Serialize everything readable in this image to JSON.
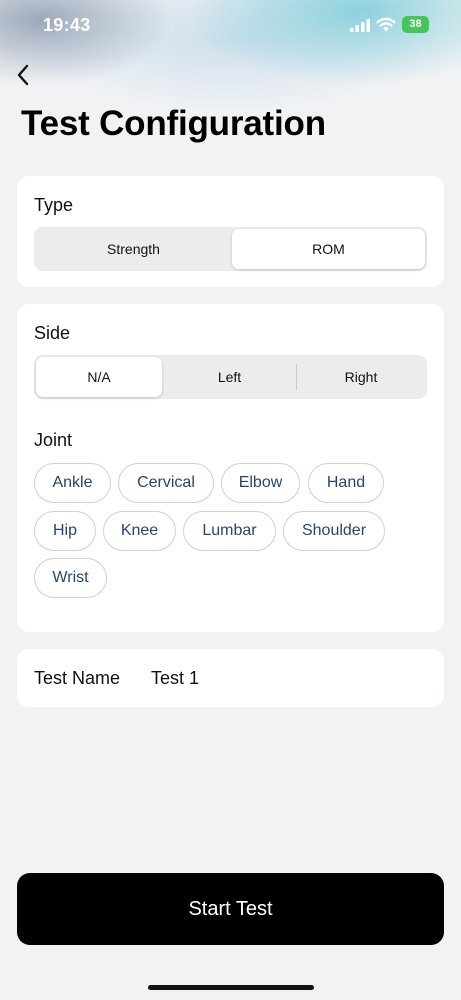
{
  "status_bar": {
    "time": "19:43",
    "battery": "38",
    "icons": [
      "signal-icon",
      "wifi-icon",
      "battery-icon"
    ]
  },
  "header": {
    "back_icon": "chevron-left-icon",
    "title": "Test Configuration"
  },
  "type_section": {
    "label": "Type",
    "options": [
      "Strength",
      "ROM"
    ],
    "selected": "ROM"
  },
  "side_section": {
    "label": "Side",
    "options": [
      "N/A",
      "Left",
      "Right"
    ],
    "selected": "N/A"
  },
  "joint_section": {
    "label": "Joint",
    "chips": [
      "Ankle",
      "Cervical",
      "Elbow",
      "Hand",
      "Hip",
      "Knee",
      "Lumbar",
      "Shoulder",
      "Wrist"
    ]
  },
  "test_name": {
    "label": "Test Name",
    "value": "Test 1"
  },
  "start_button": {
    "label": "Start Test"
  },
  "colors": {
    "background": "#f1f2f4",
    "card": "#ffffff",
    "chip_text": "#27456f",
    "primary_button": "#000000",
    "battery": "#45c65a"
  }
}
